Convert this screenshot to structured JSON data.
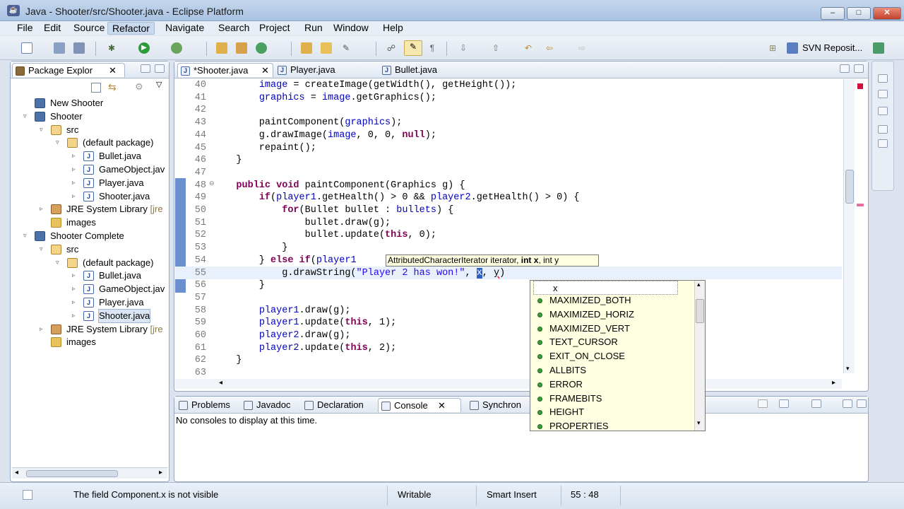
{
  "window": {
    "title": "Java - Shooter/src/Shooter.java - Eclipse Platform",
    "minimize": "–",
    "maximize": "□",
    "close": "✕"
  },
  "menu": [
    "File",
    "Edit",
    "Source",
    "Refactor",
    "Navigate",
    "Search",
    "Project",
    "Run",
    "Window",
    "Help"
  ],
  "toolbar": {
    "svn_label": "SVN Reposit..."
  },
  "package_explorer": {
    "tab": "Package Explor",
    "tree": [
      {
        "label": "New Shooter",
        "kind": "project",
        "level": 0,
        "twisty": ""
      },
      {
        "label": "Shooter",
        "kind": "project",
        "level": 0,
        "twisty": "▿"
      },
      {
        "label": "src",
        "kind": "pkg",
        "level": 1,
        "twisty": "▿"
      },
      {
        "label": "(default package)",
        "kind": "pkg",
        "level": 2,
        "twisty": "▿"
      },
      {
        "label": "Bullet.java",
        "kind": "java",
        "level": 3,
        "twisty": "▹"
      },
      {
        "label": "GameObject.jav",
        "kind": "java",
        "level": 3,
        "twisty": "▹"
      },
      {
        "label": "Player.java",
        "kind": "java",
        "level": 3,
        "twisty": "▹"
      },
      {
        "label": "Shooter.java",
        "kind": "java",
        "level": 3,
        "twisty": "▹"
      },
      {
        "label": "JRE System Library",
        "suffix": "[jre",
        "kind": "jar",
        "level": 1,
        "twisty": "▹"
      },
      {
        "label": "images",
        "kind": "folder",
        "level": 1,
        "twisty": ""
      },
      {
        "label": "Shooter Complete",
        "kind": "project",
        "level": 0,
        "twisty": "▿"
      },
      {
        "label": "src",
        "kind": "pkg",
        "level": 1,
        "twisty": "▿"
      },
      {
        "label": "(default package)",
        "kind": "pkg",
        "level": 2,
        "twisty": "▿"
      },
      {
        "label": "Bullet.java",
        "kind": "java",
        "level": 3,
        "twisty": "▹"
      },
      {
        "label": "GameObject.jav",
        "kind": "java",
        "level": 3,
        "twisty": "▹"
      },
      {
        "label": "Player.java",
        "kind": "java",
        "level": 3,
        "twisty": "▹"
      },
      {
        "label": "Shooter.java",
        "kind": "java",
        "level": 3,
        "twisty": "▹",
        "selected": true
      },
      {
        "label": "JRE System Library",
        "suffix": "[jre",
        "kind": "jar",
        "level": 1,
        "twisty": "▹"
      },
      {
        "label": "images",
        "kind": "folder",
        "level": 1,
        "twisty": ""
      }
    ]
  },
  "editor": {
    "tabs": [
      {
        "label": "*Shooter.java",
        "active": true,
        "close": "✕"
      },
      {
        "label": "Player.java",
        "active": false
      },
      {
        "label": "Bullet.java",
        "active": false
      }
    ],
    "lines": [
      {
        "n": "40",
        "html": "        <span class='fld'>image</span> = createImage(getWidth(), getHeight());"
      },
      {
        "n": "41",
        "html": "        <span class='fld'>graphics</span> = <span class='fld'>image</span>.getGraphics();"
      },
      {
        "n": "42",
        "html": ""
      },
      {
        "n": "43",
        "html": "        paintComponent(<span class='fld'>graphics</span>);"
      },
      {
        "n": "44",
        "html": "        g.drawImage(<span class='fld'>image</span>, 0, 0, <span class='kw'>null</span>);"
      },
      {
        "n": "45",
        "html": "        repaint();"
      },
      {
        "n": "46",
        "html": "    }"
      },
      {
        "n": "47",
        "html": ""
      },
      {
        "n": "48",
        "html": "    <span class='kw'>public</span> <span class='kw'>void</span> paintComponent(Graphics g) {"
      },
      {
        "n": "49",
        "html": "        <span class='kw'>if</span>(<span class='fld'>player1</span>.getHealth() &gt; 0 &amp;&amp; <span class='fld'>player2</span>.getHealth() &gt; 0) {"
      },
      {
        "n": "50",
        "html": "            <span class='kw'>for</span>(Bullet bullet : <span class='fld'>bullets</span>) {"
      },
      {
        "n": "51",
        "html": "                bullet.draw(g);"
      },
      {
        "n": "52",
        "html": "                bullet.update(<span class='kw'>this</span>, 0);"
      },
      {
        "n": "53",
        "html": "            }"
      },
      {
        "n": "54",
        "html": "        } <span class='kw'>else</span> <span class='kw'>if</span>(<span class='fld'>player1</span>"
      },
      {
        "n": "55",
        "html": "            g.drawString(<span class='str'>\"Player 2 has won!\"</span>, <span style='background:#3060c0;color:#fff'>x</span>, <span style='text-decoration:underline wavy red'>y</span>)"
      },
      {
        "n": "56",
        "html": "        }"
      },
      {
        "n": "57",
        "html": ""
      },
      {
        "n": "58",
        "html": "        <span class='fld'>player1</span>.draw(g);"
      },
      {
        "n": "59",
        "html": "        <span class='fld'>player1</span>.update(<span class='kw'>this</span>, 1);"
      },
      {
        "n": "60",
        "html": "        <span class='fld'>player2</span>.draw(g);"
      },
      {
        "n": "61",
        "html": "        <span class='fld'>player2</span>.update(<span class='kw'>this</span>, 2);"
      },
      {
        "n": "62",
        "html": "    }"
      },
      {
        "n": "63",
        "html": ""
      }
    ],
    "hint": {
      "prefix": "AttributedCharacterIterator iterator, ",
      "bold": "int x",
      "suffix": ", int y"
    },
    "completion_filter": "x",
    "completions": [
      "MAXIMIZED_BOTH",
      "MAXIMIZED_HORIZ",
      "MAXIMIZED_VERT",
      "TEXT_CURSOR",
      "EXIT_ON_CLOSE",
      "ALLBITS",
      "ERROR",
      "FRAMEBITS",
      "HEIGHT",
      "PROPERTIES"
    ]
  },
  "bottom": {
    "tabs": [
      {
        "label": "Problems"
      },
      {
        "label": "Javadoc"
      },
      {
        "label": "Declaration"
      },
      {
        "label": "Console",
        "active": true,
        "close": "✕"
      },
      {
        "label": "Synchron"
      }
    ],
    "console_text": "No consoles to display at this time."
  },
  "statusbar": {
    "message": "The field Component.x is not visible",
    "mode": "Writable",
    "insert": "Smart Insert",
    "position": "55 : 48"
  },
  "colors": {
    "keyword": "#7f0055",
    "field": "#0000c0",
    "string": "#2a00ff"
  }
}
